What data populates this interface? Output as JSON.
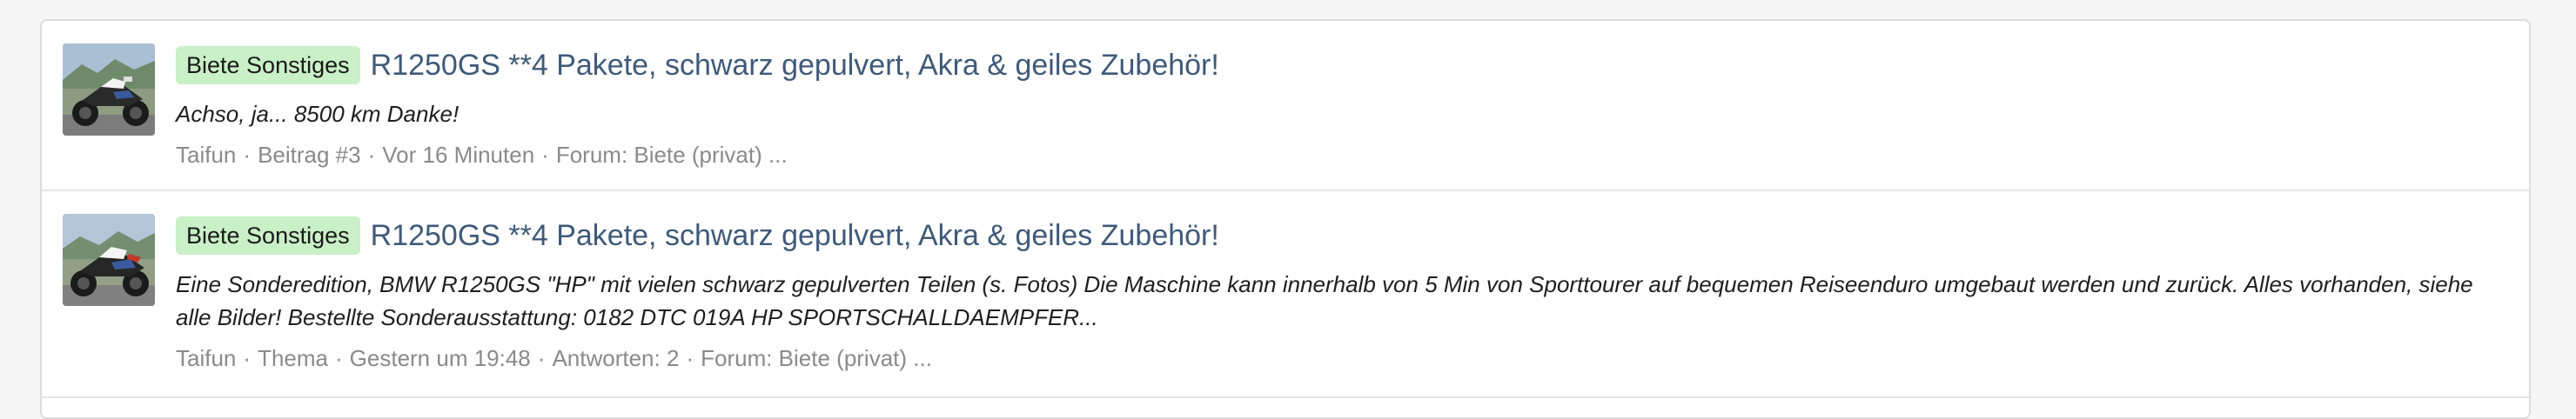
{
  "results": [
    {
      "prefix": "Biete Sonstiges",
      "title": "R1250GS **4 Pakete, schwarz gepulvert, Akra & geiles Zubehör!",
      "snippet": "Achso, ja... 8500 km Danke!",
      "meta": {
        "author": "Taifun",
        "type": "Beitrag #3",
        "time": "Vor 16 Minuten",
        "forum": "Forum: Biete (privat)",
        "ellipsis": "..."
      }
    },
    {
      "prefix": "Biete Sonstiges",
      "title": "R1250GS **4 Pakete, schwarz gepulvert, Akra & geiles Zubehör!",
      "snippet": "Eine Sonderedition, BMW R1250GS \"HP\" mit vielen schwarz gepulverten Teilen (s. Fotos) Die Maschine kann innerhalb von 5 Min von Sporttourer auf bequemen Reiseenduro umgebaut werden und zurück. Alles vorhanden, siehe alle Bilder! Bestellte Sonderausstattung: 0182 DTC 019A HP SPORTSCHALLDAEMPFER...",
      "meta": {
        "author": "Taifun",
        "type": "Thema",
        "time": "Gestern um 19:48",
        "replies": "Antworten: 2",
        "forum": "Forum: Biete (privat)",
        "ellipsis": "..."
      }
    }
  ],
  "meta_separator": "·",
  "colors": {
    "badge_bg": "#c9f0c6",
    "title": "#3f5a78",
    "meta": "#8a8a8a"
  }
}
